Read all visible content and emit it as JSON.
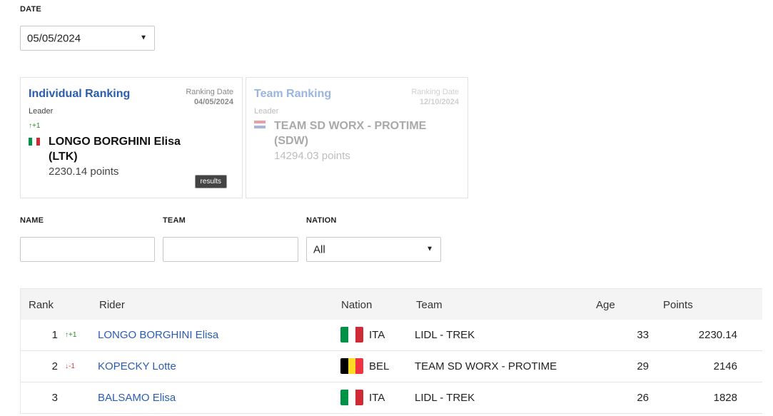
{
  "filters": {
    "date_label": "DATE",
    "date_value": "05/05/2024",
    "name_label": "NAME",
    "team_label": "TEAM",
    "nation_label": "NATION",
    "nation_value": "All"
  },
  "individual_card": {
    "title": "Individual Ranking",
    "ranking_date_label": "Ranking Date",
    "ranking_date": "04/05/2024",
    "leader_label": "Leader",
    "movement": "↑+1",
    "leader_name": "LONGO BORGHINI Elisa (LTK)",
    "points": "2230.14 points",
    "results_button": "results",
    "flag_colors": [
      "#009246",
      "#ffffff",
      "#ce2b37"
    ]
  },
  "team_card": {
    "title": "Team Ranking",
    "ranking_date_label": "Ranking Date",
    "ranking_date": "12/10/2024",
    "leader_label": "Leader",
    "leader_name": "TEAM SD WORX - PROTIME (SDW)",
    "points": "14294.03 points",
    "flag_colors": [
      "#ae1c28",
      "#ffffff",
      "#21468b"
    ]
  },
  "table": {
    "headers": {
      "rank": "Rank",
      "rider": "Rider",
      "nation": "Nation",
      "team": "Team",
      "age": "Age",
      "points": "Points"
    },
    "rows": [
      {
        "rank": "1",
        "movement": "↑+1",
        "movement_dir": "up",
        "rider": "LONGO BORGHINI Elisa",
        "nation": "ITA",
        "flag_colors": [
          "#009246",
          "#ffffff",
          "#ce2b37"
        ],
        "team": "LIDL - TREK",
        "age": "33",
        "points": "2230.14"
      },
      {
        "rank": "2",
        "movement": "↓-1",
        "movement_dir": "down",
        "rider": "KOPECKY Lotte",
        "nation": "BEL",
        "flag_colors": [
          "#000000",
          "#fdda24",
          "#ef3340"
        ],
        "team": "TEAM SD WORX - PROTIME",
        "age": "29",
        "points": "2146"
      },
      {
        "rank": "3",
        "movement": "",
        "movement_dir": "",
        "rider": "BALSAMO Elisa",
        "nation": "ITA",
        "flag_colors": [
          "#009246",
          "#ffffff",
          "#ce2b37"
        ],
        "team": "LIDL - TREK",
        "age": "26",
        "points": "1828"
      }
    ]
  },
  "colors": {
    "link": "#2a5db0",
    "up": "#2a8a2a",
    "down": "#d23a3a"
  }
}
